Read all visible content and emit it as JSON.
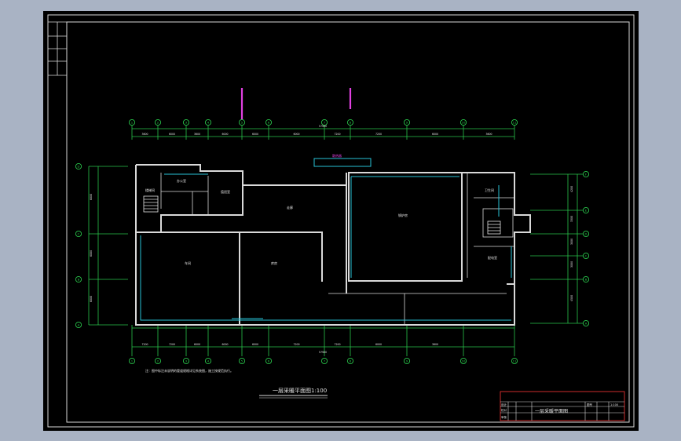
{
  "drawing": {
    "plan_title": "一层采暖平面图1:100",
    "note": "注：图中标注未说明的管道规格详见系统图，施工按规范执行。",
    "legend_label": "散热器",
    "title_block": {
      "drawing_name": "一层采暖平面图",
      "scale": "1:100",
      "sheet_label": "图号",
      "designed": "设计",
      "checked": "校对",
      "approved": "审核"
    },
    "top_axes": [
      "1",
      "2",
      "3",
      "4",
      "5",
      "6",
      "7",
      "8",
      "9",
      "10",
      "11"
    ],
    "bottom_axes": [
      "1",
      "2",
      "3",
      "4",
      "5",
      "6",
      "7",
      "8",
      "9",
      "10",
      "11"
    ],
    "left_axes": [
      "D",
      "C",
      "B",
      "A"
    ],
    "right_axes": [
      "F",
      "E",
      "D",
      "C",
      "B",
      "A"
    ],
    "top_dims": [
      "3600",
      "6000",
      "3600",
      "6000",
      "6000",
      "6000",
      "7200",
      "7200",
      "6000",
      "3600"
    ],
    "top_total": "57900",
    "bottom_dims": [
      "7200",
      "7200",
      "6000",
      "6000",
      "6000",
      "7200",
      "7200",
      "6000",
      "3600"
    ],
    "bottom_total": "57900",
    "left_dims": [
      "6000",
      "6000",
      "6000"
    ],
    "right_dims": [
      "4200",
      "3300",
      "3000",
      "3000",
      "4500"
    ],
    "room_labels": [
      "办公室",
      "值班室",
      "车间",
      "库房",
      "锅炉房",
      "配电室",
      "楼梯间",
      "卫生间",
      "走廊"
    ],
    "colors": {
      "background": "#000000",
      "frame": "#d9d9d9",
      "axis_lines": "#29c34a",
      "radiators": "#29c2d6",
      "risers": "#e040e0",
      "title_block_border": "#e03030"
    }
  }
}
